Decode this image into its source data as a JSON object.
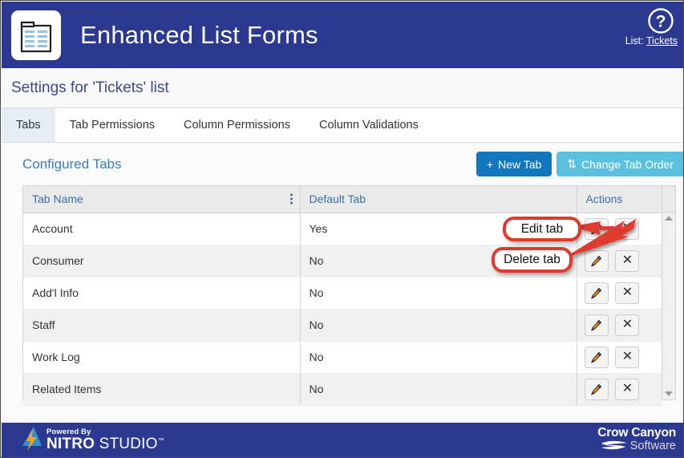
{
  "header": {
    "title": "Enhanced List Forms",
    "app_icon": "list-document-icon",
    "help_icon": "question-circle-icon",
    "list_label": "List:",
    "list_value": "Tickets",
    "bg_color": "#2b3990"
  },
  "settings": {
    "title": "Settings for 'Tickets' list"
  },
  "tabs": [
    {
      "label": "Tabs",
      "active": true
    },
    {
      "label": "Tab Permissions",
      "active": false
    },
    {
      "label": "Column Permissions",
      "active": false
    },
    {
      "label": "Column Validations",
      "active": false
    }
  ],
  "section": {
    "title": "Configured Tabs",
    "new_tab_button": {
      "label": "New Tab",
      "glyph": "+",
      "color": "#1278be"
    },
    "change_order_button": {
      "label": "Change Tab Order",
      "glyph": "⇅",
      "color": "#5bc0de"
    }
  },
  "table": {
    "columns": [
      "Tab Name",
      "Default Tab",
      "Actions"
    ],
    "kebab_icon": "more-vertical-icon",
    "edit_icon": "pencil-icon",
    "delete_icon": "close-x-icon",
    "rows": [
      {
        "name": "Account",
        "default": "Yes"
      },
      {
        "name": "Consumer",
        "default": "No"
      },
      {
        "name": "Add'l Info",
        "default": "No"
      },
      {
        "name": "Staff",
        "default": "No"
      },
      {
        "name": "Work Log",
        "default": "No"
      },
      {
        "name": "Related Items",
        "default": "No"
      }
    ]
  },
  "scrollbar": {
    "up_icon": "triangle-up-icon",
    "down_icon": "triangle-down-icon"
  },
  "callouts": [
    {
      "id": "edit",
      "text": "Edit tab",
      "color": "#e03a2f"
    },
    {
      "id": "delete",
      "text": "Delete tab",
      "color": "#e03a2f"
    }
  ],
  "footer": {
    "powered_by": "Powered By",
    "nitro_bold": "NITRO",
    "nitro_light": "STUDIO",
    "nitro_tm": "™",
    "nitro_icon": "lightning-bolt-icon",
    "crow_top": "Crow Canyon",
    "crow_bottom": "Software",
    "crow_icon": "wave-swoosh-icon",
    "bg_color": "#2b3990"
  }
}
